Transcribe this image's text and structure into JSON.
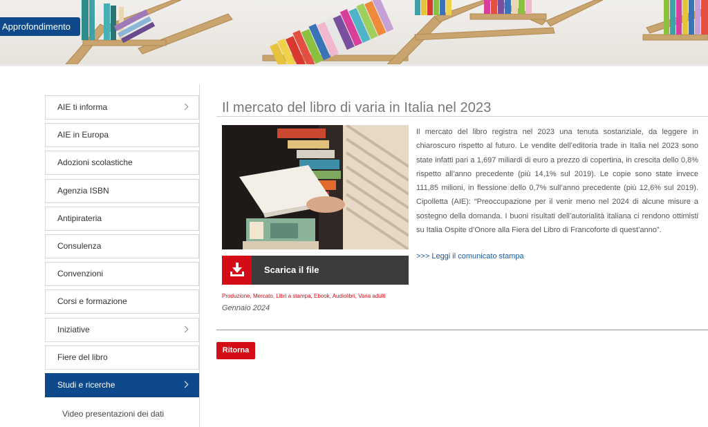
{
  "header": {
    "section_badge": "Approfondimento"
  },
  "sidebar": {
    "items": [
      {
        "label": "AIE ti informa",
        "has_submenu": true,
        "active": false
      },
      {
        "label": "AIE in Europa",
        "has_submenu": false,
        "active": false
      },
      {
        "label": "Adozioni scolastiche",
        "has_submenu": false,
        "active": false
      },
      {
        "label": "Agenzia ISBN",
        "has_submenu": false,
        "active": false
      },
      {
        "label": "Antipirateria",
        "has_submenu": false,
        "active": false
      },
      {
        "label": "Consulenza",
        "has_submenu": false,
        "active": false
      },
      {
        "label": "Convenzioni",
        "has_submenu": false,
        "active": false
      },
      {
        "label": "Corsi e formazione",
        "has_submenu": false,
        "active": false
      },
      {
        "label": "Iniziative",
        "has_submenu": true,
        "active": false
      },
      {
        "label": "Fiere del libro",
        "has_submenu": false,
        "active": false
      },
      {
        "label": "Studi e ricerche",
        "has_submenu": true,
        "active": true
      }
    ],
    "subitem": "Video presentazioni dei dati"
  },
  "article": {
    "title": "Il mercato del libro di varia in Italia nel 2023",
    "body": "Il mercato del libro registra nel 2023 una tenuta sostanziale, da leggere in chiaroscuro rispetto al futuro. Le vendite dell’editoria trade in Italia nel 2023 sono state infatti pari a 1,697 miliardi di euro a prezzo di copertina, in crescita dello 0,8% rispetto all’anno precedente (più 14,1% sul 2019). Le copie sono state invece 111,85 milioni, in flessione dello 0,7% sull’anno precedente (più 12,6% sul 2019). Cipolletta (AIE): “Preoccupazione per il venir meno nel 2024 di alcune misure a sostegno della domanda. I buoni risultati dell’autorialità italiana ci rendono ottimisti su Italia Ospite d’Onore alla Fiera del Libro di Francoforte di quest’anno”.",
    "press_link": ">>> Leggi il comunicato stampa",
    "download_label": "Scarica il file",
    "tags": [
      "Produzione",
      "Mercato",
      "Libri a stampa",
      "Ebook",
      "Audiolibri",
      "Varia adulti"
    ],
    "date": "Gennaio 2024"
  },
  "actions": {
    "back_label": "Ritorna"
  },
  "colors": {
    "brand_blue": "#0e4a8b",
    "accent_red": "#d40c17",
    "download_bar": "#3c3c3c"
  },
  "icons": {
    "download": "download-icon",
    "chevron": "chevron-right-icon"
  }
}
